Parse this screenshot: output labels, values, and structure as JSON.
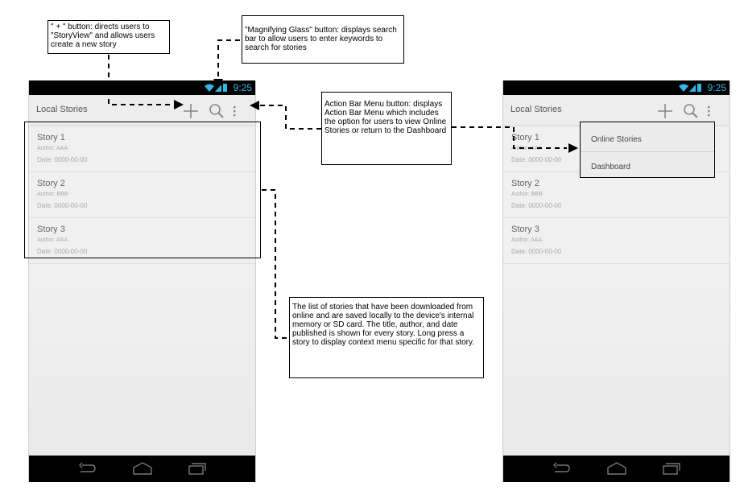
{
  "status": {
    "time": "9:25"
  },
  "left_screen": {
    "title": "Local Stories",
    "stories": [
      {
        "title": "Story 1",
        "author": "Author: AAA",
        "date": "Date: 0000-00-00"
      },
      {
        "title": "Story 2",
        "author": "Author: BBB",
        "date": "Date: 0000-00-00"
      },
      {
        "title": "Story 3",
        "author": "Author: AAA",
        "date": "Date: 0000-00-00"
      }
    ]
  },
  "right_screen": {
    "title": "Local Stories",
    "stories": [
      {
        "title": "Story 1",
        "author": "Author: AAA",
        "date": "Date: 0000-00-00"
      },
      {
        "title": "Story 2",
        "author": "Author: BBB",
        "date": "Date: 0000-00-00"
      },
      {
        "title": "Story 3",
        "author": "Author: AAA",
        "date": "Date: 0000-00-00"
      }
    ],
    "menu": [
      "Online Stories",
      "Dashboard"
    ]
  },
  "annotations": {
    "plus": "\" + \" button: directs users to \"StoryView\" and allows users create a new story",
    "search": "\"Magnifying Glass\" button: displays search bar to allow users to enter keywords to search for stories",
    "menu": "Action Bar Menu button: displays Action Bar Menu which includes the option for users to view Online Stories or return to the Dashboard",
    "list": "The list of stories that have been downloaded from online and are saved locally to the device's internal memory or SD card. The title, author, and date published is shown for every story. Long press a story to display context menu specific for that story."
  },
  "colors": {
    "status_accent": "#33b5e5",
    "statusbar": "#000000",
    "actionbar": "#ededed"
  },
  "icons": [
    "wifi-icon",
    "signal-icon",
    "battery-icon",
    "plus-icon",
    "search-icon",
    "overflow-menu-icon",
    "back-icon",
    "home-icon",
    "recent-apps-icon"
  ]
}
